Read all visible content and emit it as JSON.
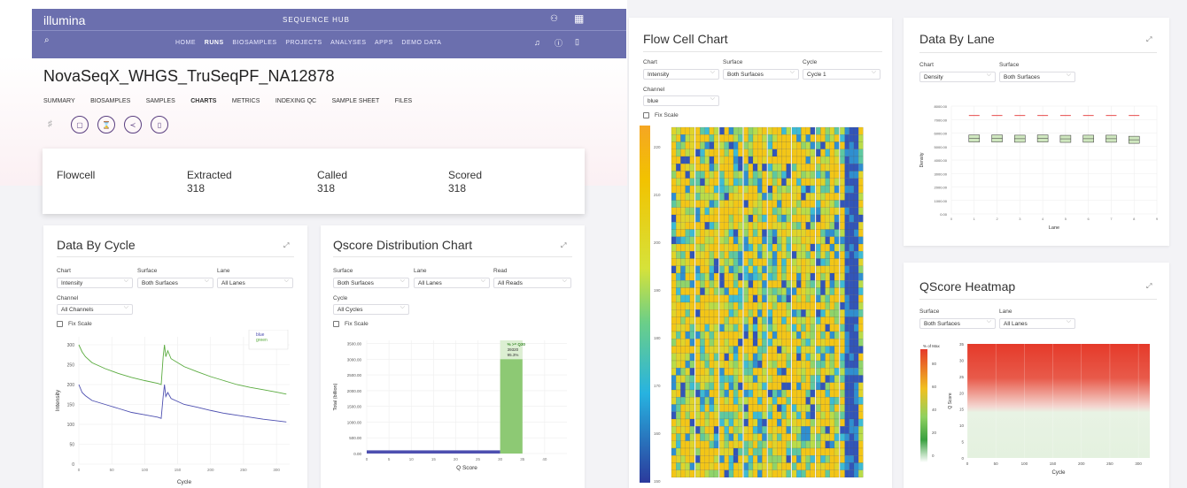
{
  "header": {
    "logo": "illumina",
    "app_name": "SEQUENCE HUB",
    "nav": [
      "HOME",
      "RUNS",
      "BIOSAMPLES",
      "PROJECTS",
      "ANALYSES",
      "APPS",
      "DEMO DATA"
    ]
  },
  "run": {
    "title": "NovaSeqX_WHGS_TruSeqPF_NA12878",
    "tabs": [
      "SUMMARY",
      "BIOSAMPLES",
      "SAMPLES",
      "CHARTS",
      "METRICS",
      "INDEXING QC",
      "SAMPLE SHEET",
      "FILES"
    ],
    "active_tab": "CHARTS"
  },
  "summary": {
    "flowcell_label": "Flowcell",
    "extracted_label": "Extracted",
    "extracted_value": "318",
    "called_label": "Called",
    "called_value": "318",
    "scored_label": "Scored",
    "scored_value": "318"
  },
  "data_by_cycle": {
    "title": "Data By Cycle",
    "chart_label": "Chart",
    "chart_value": "Intensity",
    "surface_label": "Surface",
    "surface_value": "Both Surfaces",
    "lane_label": "Lane",
    "lane_value": "All Lanes",
    "channel_label": "Channel",
    "channel_value": "All Channels",
    "fix_scale": "Fix Scale"
  },
  "qscore_dist": {
    "title": "Qscore Distribution Chart",
    "surface_label": "Surface",
    "surface_value": "Both Surfaces",
    "lane_label": "Lane",
    "lane_value": "All Lanes",
    "read_label": "Read",
    "read_value": "All Reads",
    "cycle_label": "Cycle",
    "cycle_value": "All Cycles",
    "fix_scale": "Fix Scale"
  },
  "flow_cell": {
    "title": "Flow Cell Chart",
    "chart_label": "Chart",
    "chart_value": "Intensity",
    "surface_label": "Surface",
    "surface_value": "Both Surfaces",
    "cycle_label": "Cycle",
    "cycle_value": "Cycle 1",
    "channel_label": "Channel",
    "channel_value": "blue",
    "fix_scale": "Fix Scale"
  },
  "data_by_lane": {
    "title": "Data By Lane",
    "chart_label": "Chart",
    "chart_value": "Density",
    "surface_label": "Surface",
    "surface_value": "Both Surfaces"
  },
  "qscore_heatmap": {
    "title": "QScore Heatmap",
    "surface_label": "Surface",
    "surface_value": "Both Surfaces",
    "lane_label": "Lane",
    "lane_value": "All Lanes"
  },
  "colors": {
    "header": "#6b6fae",
    "accent": "#5a3f80",
    "green": "#5aab3f",
    "blue": "#4d4fb0",
    "red": "#e43a3a"
  },
  "chart_data": [
    {
      "type": "line",
      "xlabel": "Cycle",
      "ylabel": "Intensity",
      "xticks": [
        "0",
        "50",
        "100",
        "150",
        "200",
        "250",
        "300"
      ],
      "yticks": [
        "0",
        "50",
        "100",
        "150",
        "200",
        "250",
        "300"
      ],
      "ylim": [
        0,
        320
      ],
      "x": [
        0,
        5,
        10,
        20,
        40,
        60,
        80,
        100,
        120,
        125,
        128,
        130,
        132,
        135,
        140,
        160,
        180,
        200,
        220,
        240,
        260,
        280,
        300,
        315
      ],
      "series": [
        {
          "name": "blue",
          "values": [
            200,
            180,
            172,
            160,
            150,
            140,
            130,
            124,
            118,
            115,
            170,
            200,
            170,
            180,
            165,
            150,
            143,
            135,
            128,
            123,
            118,
            113,
            109,
            106
          ]
        },
        {
          "name": "green",
          "values": [
            300,
            282,
            270,
            255,
            240,
            228,
            218,
            210,
            203,
            200,
            270,
            300,
            270,
            285,
            265,
            245,
            232,
            220,
            210,
            200,
            193,
            187,
            181,
            176
          ]
        }
      ],
      "legend_position": "top-right"
    },
    {
      "type": "bar",
      "xlabel": "Q Score",
      "ylabel": "Total (billion)",
      "xticks": [
        "0",
        "5",
        "10",
        "15",
        "20",
        "25",
        "30",
        "35",
        "40"
      ],
      "yticks": [
        "0.00",
        "500.00",
        "1000.00",
        "1500.00",
        "2000.00",
        "2500.00",
        "3000.00",
        "3500.00"
      ],
      "ylim": [
        0,
        3600
      ],
      "bars": [
        {
          "x0": 0,
          "x1": 30,
          "value": 45
        },
        {
          "x0": 30,
          "x1": 35,
          "value": 3000
        }
      ],
      "annotation": [
        "% >= Q30",
        "39320",
        "95.3%"
      ]
    },
    {
      "type": "heatmap",
      "colorbar_ticks": [
        "220",
        "210",
        "200",
        "190",
        "180",
        "170",
        "160",
        "150"
      ],
      "columns": 8,
      "rows": 48
    },
    {
      "type": "scatter",
      "xlabel": "Lane",
      "ylabel": "Density",
      "xticks": [
        "0",
        "1",
        "2",
        "3",
        "4",
        "5",
        "6",
        "7",
        "8",
        "9"
      ],
      "yticks": [
        "0.00",
        "1000.00",
        "2000.00",
        "3000.00",
        "4000.00",
        "5000.00",
        "6000.00",
        "7000.00",
        "8000.00"
      ],
      "ylim": [
        0,
        8000
      ],
      "red_values": [
        7300,
        7300,
        7300,
        7300,
        7300,
        7300,
        7300,
        7300
      ],
      "box_values": [
        5600,
        5600,
        5580,
        5600,
        5570,
        5580,
        5580,
        5500
      ]
    },
    {
      "type": "heatmap",
      "xlabel": "Cycle",
      "ylabel": "Q Score",
      "colorbar_label": "% of Max",
      "colorbar_ticks": [
        "80",
        "60",
        "40",
        "20",
        "0"
      ],
      "xticks": [
        "0",
        "50",
        "100",
        "150",
        "200",
        "250",
        "300"
      ],
      "yticks": [
        "0",
        "5",
        "10",
        "15",
        "20",
        "25",
        "30",
        "35"
      ]
    }
  ]
}
